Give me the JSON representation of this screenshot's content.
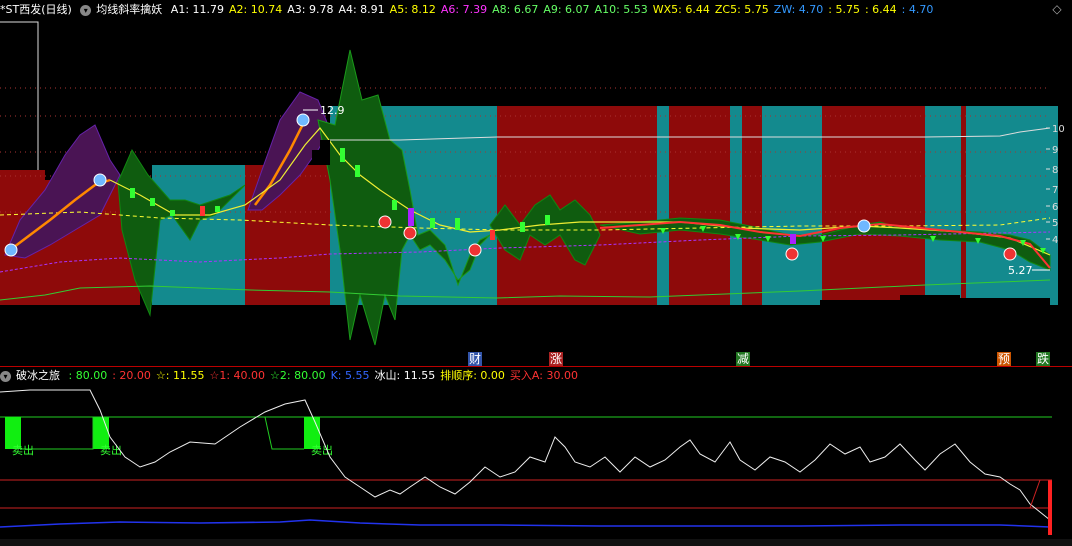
{
  "main_indicator": {
    "stock_name": "*ST西发(日线)",
    "indicator_name": "均线斜率擒妖",
    "values": [
      {
        "label": "A1:",
        "value": "11.79",
        "color": "#ffffff"
      },
      {
        "label": "A2:",
        "value": "10.74",
        "color": "#ffff00"
      },
      {
        "label": "A3:",
        "value": "9.78",
        "color": "#ffffff"
      },
      {
        "label": "A4:",
        "value": "8.91",
        "color": "#ffffff"
      },
      {
        "label": "A5:",
        "value": "8.12",
        "color": "#ffff00"
      },
      {
        "label": "A6:",
        "value": "7.39",
        "color": "#ff33ff"
      },
      {
        "label": "A8:",
        "value": "6.67",
        "color": "#66ff66"
      },
      {
        "label": "A9:",
        "value": "6.07",
        "color": "#66ff66"
      },
      {
        "label": "A10:",
        "value": "5.53",
        "color": "#66ff66"
      },
      {
        "label": "WX5:",
        "value": "6.44",
        "color": "#ffff00"
      },
      {
        "label": "ZC5:",
        "value": "5.75",
        "color": "#ffff00"
      },
      {
        "label": "ZW:",
        "value": "4.70",
        "color": "#3399ff"
      },
      {
        "label": ":",
        "value": "5.75",
        "color": "#ffff00"
      },
      {
        "label": ":",
        "value": "6.44",
        "color": "#ffff00"
      },
      {
        "label": ":",
        "value": "4.70",
        "color": "#3399ff"
      }
    ],
    "price_high_label": "12.9",
    "price_low_label": "5.27",
    "y_axis": [
      "10",
      "9",
      "8",
      "7",
      "6",
      "5",
      "4"
    ]
  },
  "event_labels": [
    {
      "text": "财",
      "color": "#ffffff",
      "bg": "#3355aa"
    },
    {
      "text": "涨",
      "color": "#ffffff",
      "bg": "#aa2222"
    },
    {
      "text": "减",
      "color": "#ffffff",
      "bg": "#227722"
    },
    {
      "text": "预",
      "color": "#ffffff",
      "bg": "#cc5500"
    },
    {
      "text": "跌",
      "color": "#ffffff",
      "bg": "#227722"
    }
  ],
  "sub_indicator": {
    "name": "破冰之旅",
    "values": [
      {
        "label": ":",
        "value": "80.00",
        "color": "#33ff33"
      },
      {
        "label": ":",
        "value": "20.00",
        "color": "#ff3333"
      },
      {
        "label": "☆:",
        "value": "11.55",
        "color": "#ffff00"
      },
      {
        "label": "☆1:",
        "value": "40.00",
        "color": "#ff3333"
      },
      {
        "label": "☆2:",
        "value": "80.00",
        "color": "#33ff33"
      },
      {
        "label": "K:",
        "value": "5.55",
        "color": "#3366ff"
      },
      {
        "label": "冰山:",
        "value": "11.55",
        "color": "#ffffff"
      },
      {
        "label": "排顺序:",
        "value": "0.00",
        "color": "#ffff00"
      },
      {
        "label": "买入A:",
        "value": "30.00",
        "color": "#ff3333"
      }
    ],
    "sell_labels": [
      "卖出",
      "卖出",
      "卖出"
    ]
  },
  "colors": {
    "teal": "#138a8e",
    "red": "#8e0a0a",
    "green_cloud": "#0f5c0f",
    "purple_cloud": "#4a1454"
  }
}
